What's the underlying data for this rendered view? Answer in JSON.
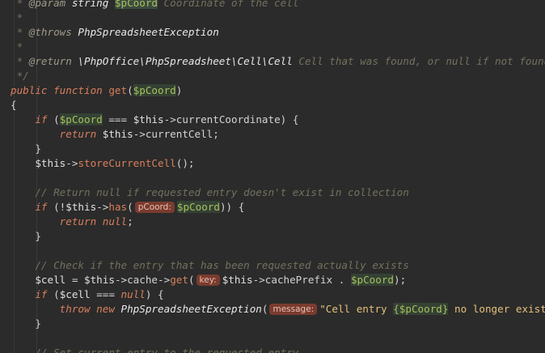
{
  "editor": {
    "language": "PHP",
    "colors": {
      "background": "#2b2b2b",
      "comment": "#75715e",
      "keyword": "#d97f5d",
      "variable": "#a6c15b",
      "string": "#e5c07b",
      "hint_bg": "#7a3b2e"
    },
    "lines": [
      [
        {
          "t": " * ",
          "c": "comment"
        },
        {
          "t": "@param",
          "c": "tag"
        },
        {
          "t": " string ",
          "c": "doctype"
        },
        {
          "t": "$pCoord",
          "c": "varhl"
        },
        {
          "t": " Coordinate of the cell",
          "c": "comment"
        }
      ],
      [
        {
          "t": " *",
          "c": "comment"
        }
      ],
      [
        {
          "t": " * ",
          "c": "comment"
        },
        {
          "t": "@throws",
          "c": "tag"
        },
        {
          "t": " PhpSpreadsheetException",
          "c": "doctype"
        }
      ],
      [
        {
          "t": " *",
          "c": "comment"
        }
      ],
      [
        {
          "t": " * ",
          "c": "comment"
        },
        {
          "t": "@return",
          "c": "tag"
        },
        {
          "t": " \\PhpOffice\\PhpSpreadsheet\\Cell\\Cell",
          "c": "doctype"
        },
        {
          "t": " Cell that was found, or null if not found",
          "c": "comment"
        }
      ],
      [
        {
          "t": " */",
          "c": "comment"
        }
      ],
      [
        {
          "t": "public function ",
          "c": "keyword"
        },
        {
          "t": "get",
          "c": "func"
        },
        {
          "t": "(",
          "c": "plain"
        },
        {
          "t": "$pCoord",
          "c": "varbox"
        },
        {
          "t": ")",
          "c": "plain"
        }
      ],
      [
        {
          "t": "{",
          "c": "plain"
        }
      ],
      [
        {
          "t": "    ",
          "c": "plain"
        },
        {
          "t": "if",
          "c": "keyword"
        },
        {
          "t": " (",
          "c": "plain"
        },
        {
          "t": "$pCoord",
          "c": "varbox"
        },
        {
          "t": " === ",
          "c": "plain"
        },
        {
          "t": "$this",
          "c": "dark"
        },
        {
          "t": "->currentCoordinate) {",
          "c": "plain"
        }
      ],
      [
        {
          "t": "        ",
          "c": "plain"
        },
        {
          "t": "return",
          "c": "keyword"
        },
        {
          "t": " ",
          "c": "plain"
        },
        {
          "t": "$this",
          "c": "dark"
        },
        {
          "t": "->currentCell;",
          "c": "plain"
        }
      ],
      [
        {
          "t": "    }",
          "c": "plain"
        }
      ],
      [
        {
          "t": "    ",
          "c": "plain"
        },
        {
          "t": "$this",
          "c": "dark"
        },
        {
          "t": "->",
          "c": "plain"
        },
        {
          "t": "storeCurrentCell",
          "c": "func"
        },
        {
          "t": "();",
          "c": "plain"
        }
      ],
      [],
      [
        {
          "t": "    // Return null if requested entry doesn't exist in collection",
          "c": "comment"
        }
      ],
      [
        {
          "t": "    ",
          "c": "plain"
        },
        {
          "t": "if",
          "c": "keyword"
        },
        {
          "t": " (!",
          "c": "plain"
        },
        {
          "t": "$this",
          "c": "dark"
        },
        {
          "t": "->",
          "c": "plain"
        },
        {
          "t": "has",
          "c": "func"
        },
        {
          "t": "(",
          "c": "plain"
        },
        {
          "t": "pCoord:",
          "c": "hint"
        },
        {
          "t": "$pCoord",
          "c": "varbox"
        },
        {
          "t": ")) {",
          "c": "plain"
        }
      ],
      [
        {
          "t": "        ",
          "c": "plain"
        },
        {
          "t": "return null",
          "c": "keyword"
        },
        {
          "t": ";",
          "c": "plain"
        }
      ],
      [
        {
          "t": "    }",
          "c": "plain"
        }
      ],
      [],
      [
        {
          "t": "    // Check if the entry that has been requested actually exists",
          "c": "comment"
        }
      ],
      [
        {
          "t": "    ",
          "c": "plain"
        },
        {
          "t": "$cell",
          "c": "dark"
        },
        {
          "t": " = ",
          "c": "plain"
        },
        {
          "t": "$this",
          "c": "dark"
        },
        {
          "t": "->cache->",
          "c": "plain"
        },
        {
          "t": "get",
          "c": "func"
        },
        {
          "t": "(",
          "c": "plain"
        },
        {
          "t": "key:",
          "c": "hint"
        },
        {
          "t": "$this",
          "c": "dark"
        },
        {
          "t": "->cachePrefix . ",
          "c": "plain"
        },
        {
          "t": "$pCoord",
          "c": "varbox"
        },
        {
          "t": ");",
          "c": "plain"
        }
      ],
      [
        {
          "t": "    ",
          "c": "plain"
        },
        {
          "t": "if",
          "c": "keyword"
        },
        {
          "t": " (",
          "c": "plain"
        },
        {
          "t": "$cell",
          "c": "dark"
        },
        {
          "t": " === ",
          "c": "plain"
        },
        {
          "t": "null",
          "c": "keyword"
        },
        {
          "t": ") {",
          "c": "plain"
        }
      ],
      [
        {
          "t": "        ",
          "c": "plain"
        },
        {
          "t": "throw new ",
          "c": "keyword"
        },
        {
          "t": "PhpSpreadsheetException",
          "c": "class"
        },
        {
          "t": "(",
          "c": "plain"
        },
        {
          "t": "message:",
          "c": "hint"
        },
        {
          "t": "\"Cell entry ",
          "c": "string"
        },
        {
          "t": "{$pCoord}",
          "c": "varbox"
        },
        {
          "t": " no longer exists in ca",
          "c": "string"
        }
      ],
      [
        {
          "t": "    }",
          "c": "plain"
        }
      ],
      [],
      [
        {
          "t": "    // Set current entry to the requested entry",
          "c": "comment"
        }
      ]
    ]
  }
}
